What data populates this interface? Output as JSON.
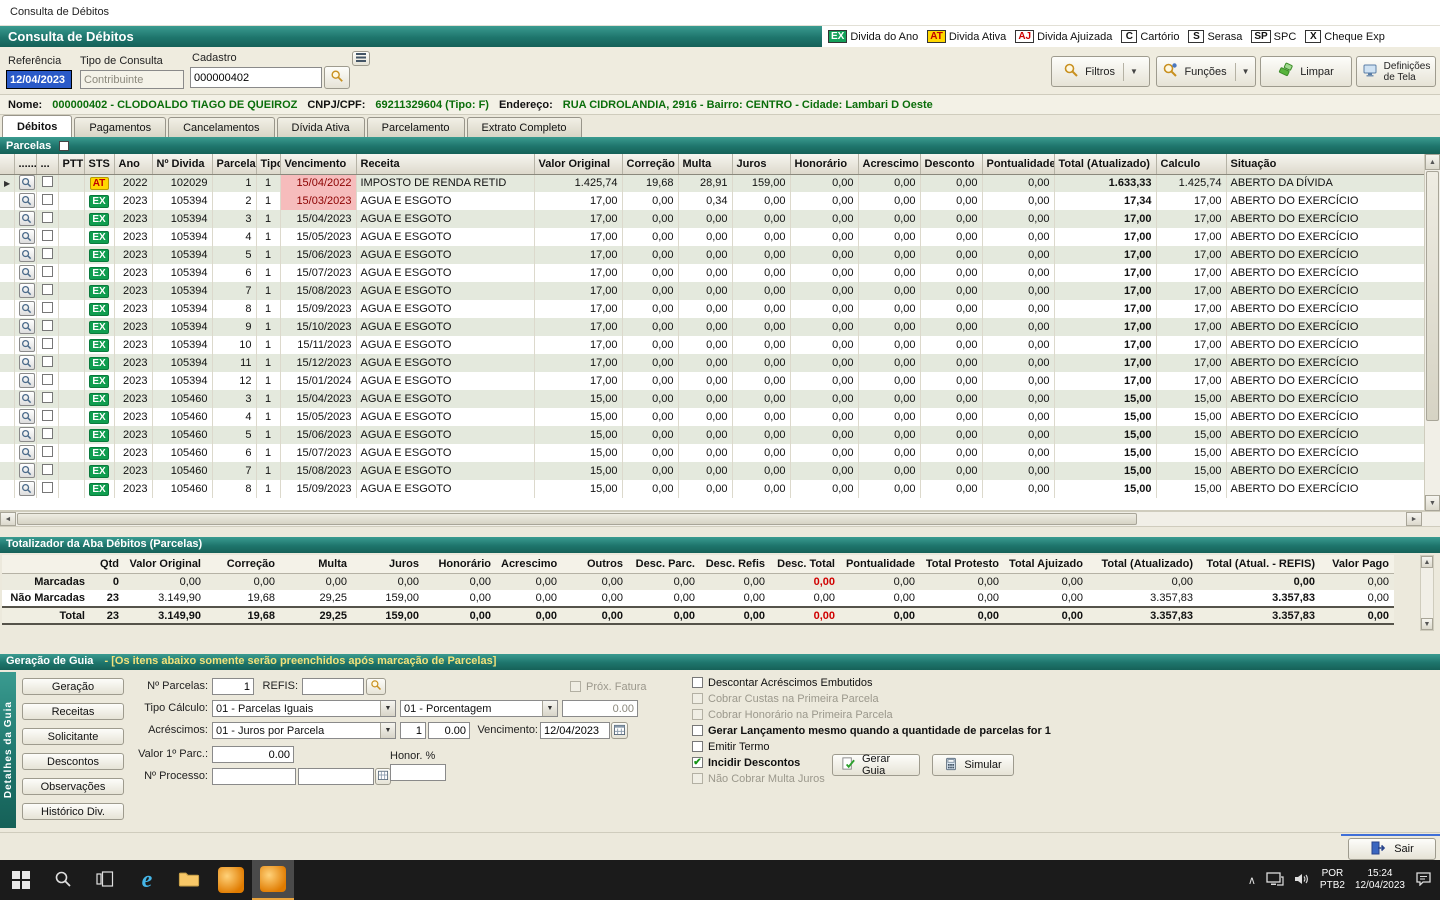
{
  "window": {
    "title": "Consulta de Débitos"
  },
  "header": {
    "title": "Consulta de Débitos",
    "legend": [
      {
        "badge": "EX",
        "label": "Divida do Ano",
        "bg": "#14a05a",
        "fg": "#ffffff"
      },
      {
        "badge": "AT",
        "label": "Divida Ativa",
        "bg": "#ffd800",
        "fg": "#c00000"
      },
      {
        "badge": "AJ",
        "label": "Divida Ajuizada",
        "bg": "#ffffff",
        "fg": "#cc0000"
      },
      {
        "badge": "C",
        "label": "Cartório",
        "bg": "#ffffff",
        "fg": "#111111"
      },
      {
        "badge": "S",
        "label": "Serasa",
        "bg": "#ffffff",
        "fg": "#111111"
      },
      {
        "badge": "SP",
        "label": "SPC",
        "bg": "#ffffff",
        "fg": "#111111"
      },
      {
        "badge": "X",
        "label": "Cheque Exp",
        "bg": "#ffffff",
        "fg": "#111111"
      }
    ]
  },
  "filters": {
    "referencia_label": "Referência",
    "referencia_value": "12/04/2023",
    "tipo_label": "Tipo de Consulta",
    "tipo_value": "Contribuinte",
    "cadastro_label": "Cadastro",
    "cadastro_value": "000000402",
    "filtros_label": "Filtros",
    "funcoes_label": "Funções",
    "limpar_label": "Limpar",
    "definicoes_label": "Definições de Tela"
  },
  "taxpayer": {
    "nome_label": "Nome:",
    "nome_value": "000000402 - CLODOALDO TIAGO DE QUEIROZ",
    "doc_label": "CNPJ/CPF:",
    "doc_value": "69211329604 (Tipo: F)",
    "end_label": "Endereço:",
    "end_value": "RUA CIDROLANDIA, 2916 - Bairro: CENTRO - Cidade: Lambari D Oeste"
  },
  "tabs": [
    {
      "label": "Débitos",
      "active": true
    },
    {
      "label": "Pagamentos"
    },
    {
      "label": "Cancelamentos"
    },
    {
      "label": "Dívida Ativa"
    },
    {
      "label": "Parcelamento"
    },
    {
      "label": "Extrato Completo"
    }
  ],
  "grid": {
    "section_title": "Parcelas",
    "columns": [
      "",
      "......",
      "...",
      "PTT",
      "STS",
      "Ano",
      "Nº Divida",
      "Parcela",
      "Tipo",
      "Vencimento",
      "Receita",
      "Valor Original",
      "Correção",
      "Multa",
      "Juros",
      "Honorário",
      "Acrescimo",
      "Desconto",
      "Pontualidade",
      "Total (Atualizado)",
      "Calculo",
      "Situação"
    ],
    "rows": [
      {
        "sel": true,
        "sts": "AT",
        "ano": "2022",
        "divida": "102029",
        "parcela": "1",
        "tipo": "1",
        "venc": "15/04/2022",
        "overdue": true,
        "receita": "IMPOSTO DE RENDA RETID",
        "valor": "1.425,74",
        "correcao": "19,68",
        "multa": "28,91",
        "juros": "159,00",
        "honorario": "0,00",
        "acrescimo": "0,00",
        "desconto": "0,00",
        "pontualidade": "0,00",
        "total": "1.633,33",
        "calculo": "1.425,74",
        "situacao": "ABERTO DA DÍVIDA"
      },
      {
        "sts": "EX",
        "ano": "2023",
        "divida": "105394",
        "parcela": "2",
        "tipo": "1",
        "venc": "15/03/2023",
        "overdue": true,
        "receita": "AGUA E ESGOTO",
        "valor": "17,00",
        "correcao": "0,00",
        "multa": "0,34",
        "juros": "0,00",
        "honorario": "0,00",
        "acrescimo": "0,00",
        "desconto": "0,00",
        "pontualidade": "0,00",
        "total": "17,34",
        "calculo": "17,00",
        "situacao": "ABERTO DO EXERCÍCIO"
      },
      {
        "sts": "EX",
        "ano": "2023",
        "divida": "105394",
        "parcela": "3",
        "tipo": "1",
        "venc": "15/04/2023",
        "receita": "AGUA E ESGOTO",
        "valor": "17,00",
        "correcao": "0,00",
        "multa": "0,00",
        "juros": "0,00",
        "honorario": "0,00",
        "acrescimo": "0,00",
        "desconto": "0,00",
        "pontualidade": "0,00",
        "total": "17,00",
        "calculo": "17,00",
        "situacao": "ABERTO DO EXERCÍCIO"
      },
      {
        "sts": "EX",
        "ano": "2023",
        "divida": "105394",
        "parcela": "4",
        "tipo": "1",
        "venc": "15/05/2023",
        "receita": "AGUA E ESGOTO",
        "valor": "17,00",
        "correcao": "0,00",
        "multa": "0,00",
        "juros": "0,00",
        "honorario": "0,00",
        "acrescimo": "0,00",
        "desconto": "0,00",
        "pontualidade": "0,00",
        "total": "17,00",
        "calculo": "17,00",
        "situacao": "ABERTO DO EXERCÍCIO"
      },
      {
        "sts": "EX",
        "ano": "2023",
        "divida": "105394",
        "parcela": "5",
        "tipo": "1",
        "venc": "15/06/2023",
        "receita": "AGUA E ESGOTO",
        "valor": "17,00",
        "correcao": "0,00",
        "multa": "0,00",
        "juros": "0,00",
        "honorario": "0,00",
        "acrescimo": "0,00",
        "desconto": "0,00",
        "pontualidade": "0,00",
        "total": "17,00",
        "calculo": "17,00",
        "situacao": "ABERTO DO EXERCÍCIO"
      },
      {
        "sts": "EX",
        "ano": "2023",
        "divida": "105394",
        "parcela": "6",
        "tipo": "1",
        "venc": "15/07/2023",
        "receita": "AGUA E ESGOTO",
        "valor": "17,00",
        "correcao": "0,00",
        "multa": "0,00",
        "juros": "0,00",
        "honorario": "0,00",
        "acrescimo": "0,00",
        "desconto": "0,00",
        "pontualidade": "0,00",
        "total": "17,00",
        "calculo": "17,00",
        "situacao": "ABERTO DO EXERCÍCIO"
      },
      {
        "sts": "EX",
        "ano": "2023",
        "divida": "105394",
        "parcela": "7",
        "tipo": "1",
        "venc": "15/08/2023",
        "receita": "AGUA E ESGOTO",
        "valor": "17,00",
        "correcao": "0,00",
        "multa": "0,00",
        "juros": "0,00",
        "honorario": "0,00",
        "acrescimo": "0,00",
        "desconto": "0,00",
        "pontualidade": "0,00",
        "total": "17,00",
        "calculo": "17,00",
        "situacao": "ABERTO DO EXERCÍCIO"
      },
      {
        "sts": "EX",
        "ano": "2023",
        "divida": "105394",
        "parcela": "8",
        "tipo": "1",
        "venc": "15/09/2023",
        "receita": "AGUA E ESGOTO",
        "valor": "17,00",
        "correcao": "0,00",
        "multa": "0,00",
        "juros": "0,00",
        "honorario": "0,00",
        "acrescimo": "0,00",
        "desconto": "0,00",
        "pontualidade": "0,00",
        "total": "17,00",
        "calculo": "17,00",
        "situacao": "ABERTO DO EXERCÍCIO"
      },
      {
        "sts": "EX",
        "ano": "2023",
        "divida": "105394",
        "parcela": "9",
        "tipo": "1",
        "venc": "15/10/2023",
        "receita": "AGUA E ESGOTO",
        "valor": "17,00",
        "correcao": "0,00",
        "multa": "0,00",
        "juros": "0,00",
        "honorario": "0,00",
        "acrescimo": "0,00",
        "desconto": "0,00",
        "pontualidade": "0,00",
        "total": "17,00",
        "calculo": "17,00",
        "situacao": "ABERTO DO EXERCÍCIO"
      },
      {
        "sts": "EX",
        "ano": "2023",
        "divida": "105394",
        "parcela": "10",
        "tipo": "1",
        "venc": "15/11/2023",
        "receita": "AGUA E ESGOTO",
        "valor": "17,00",
        "correcao": "0,00",
        "multa": "0,00",
        "juros": "0,00",
        "honorario": "0,00",
        "acrescimo": "0,00",
        "desconto": "0,00",
        "pontualidade": "0,00",
        "total": "17,00",
        "calculo": "17,00",
        "situacao": "ABERTO DO EXERCÍCIO"
      },
      {
        "sts": "EX",
        "ano": "2023",
        "divida": "105394",
        "parcela": "11",
        "tipo": "1",
        "venc": "15/12/2023",
        "receita": "AGUA E ESGOTO",
        "valor": "17,00",
        "correcao": "0,00",
        "multa": "0,00",
        "juros": "0,00",
        "honorario": "0,00",
        "acrescimo": "0,00",
        "desconto": "0,00",
        "pontualidade": "0,00",
        "total": "17,00",
        "calculo": "17,00",
        "situacao": "ABERTO DO EXERCÍCIO"
      },
      {
        "sts": "EX",
        "ano": "2023",
        "divida": "105394",
        "parcela": "12",
        "tipo": "1",
        "venc": "15/01/2024",
        "receita": "AGUA E ESGOTO",
        "valor": "17,00",
        "correcao": "0,00",
        "multa": "0,00",
        "juros": "0,00",
        "honorario": "0,00",
        "acrescimo": "0,00",
        "desconto": "0,00",
        "pontualidade": "0,00",
        "total": "17,00",
        "calculo": "17,00",
        "situacao": "ABERTO DO EXERCÍCIO"
      },
      {
        "sts": "EX",
        "ano": "2023",
        "divida": "105460",
        "parcela": "3",
        "tipo": "1",
        "venc": "15/04/2023",
        "receita": "AGUA E ESGOTO",
        "valor": "15,00",
        "correcao": "0,00",
        "multa": "0,00",
        "juros": "0,00",
        "honorario": "0,00",
        "acrescimo": "0,00",
        "desconto": "0,00",
        "pontualidade": "0,00",
        "total": "15,00",
        "calculo": "15,00",
        "situacao": "ABERTO DO EXERCÍCIO"
      },
      {
        "sts": "EX",
        "ano": "2023",
        "divida": "105460",
        "parcela": "4",
        "tipo": "1",
        "venc": "15/05/2023",
        "receita": "AGUA E ESGOTO",
        "valor": "15,00",
        "correcao": "0,00",
        "multa": "0,00",
        "juros": "0,00",
        "honorario": "0,00",
        "acrescimo": "0,00",
        "desconto": "0,00",
        "pontualidade": "0,00",
        "total": "15,00",
        "calculo": "15,00",
        "situacao": "ABERTO DO EXERCÍCIO"
      },
      {
        "sts": "EX",
        "ano": "2023",
        "divida": "105460",
        "parcela": "5",
        "tipo": "1",
        "venc": "15/06/2023",
        "receita": "AGUA E ESGOTO",
        "valor": "15,00",
        "correcao": "0,00",
        "multa": "0,00",
        "juros": "0,00",
        "honorario": "0,00",
        "acrescimo": "0,00",
        "desconto": "0,00",
        "pontualidade": "0,00",
        "total": "15,00",
        "calculo": "15,00",
        "situacao": "ABERTO DO EXERCÍCIO"
      },
      {
        "sts": "EX",
        "ano": "2023",
        "divida": "105460",
        "parcela": "6",
        "tipo": "1",
        "venc": "15/07/2023",
        "receita": "AGUA E ESGOTO",
        "valor": "15,00",
        "correcao": "0,00",
        "multa": "0,00",
        "juros": "0,00",
        "honorario": "0,00",
        "acrescimo": "0,00",
        "desconto": "0,00",
        "pontualidade": "0,00",
        "total": "15,00",
        "calculo": "15,00",
        "situacao": "ABERTO DO EXERCÍCIO"
      },
      {
        "sts": "EX",
        "ano": "2023",
        "divida": "105460",
        "parcela": "7",
        "tipo": "1",
        "venc": "15/08/2023",
        "receita": "AGUA E ESGOTO",
        "valor": "15,00",
        "correcao": "0,00",
        "multa": "0,00",
        "juros": "0,00",
        "honorario": "0,00",
        "acrescimo": "0,00",
        "desconto": "0,00",
        "pontualidade": "0,00",
        "total": "15,00",
        "calculo": "15,00",
        "situacao": "ABERTO DO EXERCÍCIO"
      },
      {
        "sts": "EX",
        "ano": "2023",
        "divida": "105460",
        "parcela": "8",
        "tipo": "1",
        "venc": "15/09/2023",
        "receita": "AGUA E ESGOTO",
        "valor": "15,00",
        "correcao": "0,00",
        "multa": "0,00",
        "juros": "0,00",
        "honorario": "0,00",
        "acrescimo": "0,00",
        "desconto": "0,00",
        "pontualidade": "0,00",
        "total": "15,00",
        "calculo": "15,00",
        "situacao": "ABERTO DO EXERCÍCIO"
      }
    ]
  },
  "totals": {
    "section_title": "Totalizador da Aba Débitos (Parcelas)",
    "columns": [
      "",
      "Qtd",
      "Valor Original",
      "Correção",
      "Multa",
      "Juros",
      "Honorário",
      "Acrescimo",
      "Outros",
      "Desc. Parc.",
      "Desc. Refis",
      "Desc. Total",
      "Pontualidade",
      "Total Protesto",
      "Total Ajuizado",
      "Total (Atualizado)",
      "Total (Atual. - REFIS)",
      "Valor Pago"
    ],
    "rows": [
      {
        "label": "Marcadas",
        "red": true,
        "cells": [
          "0",
          "0,00",
          "0,00",
          "0,00",
          "0,00",
          "0,00",
          "0,00",
          "0,00",
          "0,00",
          "0,00",
          "0,00",
          "0,00",
          "0,00",
          "0,00",
          "0,00",
          "0,00",
          "0,00"
        ]
      },
      {
        "label": "Não Marcadas",
        "cells": [
          "23",
          "3.149,90",
          "19,68",
          "29,25",
          "159,00",
          "0,00",
          "0,00",
          "0,00",
          "0,00",
          "0,00",
          "0,00",
          "0,00",
          "0,00",
          "0,00",
          "3.357,83",
          "3.357,83",
          "0,00"
        ]
      },
      {
        "label": "Total",
        "red": true,
        "bold": true,
        "cells": [
          "23",
          "3.149,90",
          "19,68",
          "29,25",
          "159,00",
          "0,00",
          "0,00",
          "0,00",
          "0,00",
          "0,00",
          "0,00",
          "0,00",
          "0,00",
          "0,00",
          "3.357,83",
          "3.357,83",
          "0,00"
        ]
      }
    ]
  },
  "guia": {
    "section_title": "Geração de Guia",
    "section_note": "-   [Os itens abaixo somente serão preenchidos após marcação de Parcelas]",
    "side_label": "Detalhes da Guia",
    "side_buttons": [
      "Geração",
      "Receitas",
      "Solicitante",
      "Descontos",
      "Observações",
      "Histórico Div."
    ],
    "fields": {
      "num_parcelas_label": "Nº Parcelas:",
      "num_parcelas_value": "1",
      "refis_label": "REFIS:",
      "prox_fatura_label": "Próx. Fatura",
      "tipo_calculo_label": "Tipo Cálculo:",
      "tipo_calculo_value": "01 - Parcelas Iguais",
      "tipo_calculo2_value": "01 - Porcentagem",
      "tipo_calculo_pct": "0.00",
      "acrescimos_label": "Acréscimos:",
      "acrescimos_value": "01 - Juros por Parcela",
      "acrescimos_n": "1",
      "acrescimos_v": "0.00",
      "vencimento_label": "Vencimento:",
      "vencimento_value": "12/04/2023",
      "valor_parc_label": "Valor 1º Parc.:",
      "valor_parc_value": "0.00",
      "honor_label": "Honor. %",
      "processo_label": "Nº Processo:"
    },
    "checkboxes": [
      {
        "label": "Descontar Acréscimos Embutidos",
        "checked": false,
        "disabled": false
      },
      {
        "label": "Cobrar Custas na Primeira Parcela",
        "checked": false,
        "disabled": true
      },
      {
        "label": "Cobrar Honorário na Primeira Parcela",
        "checked": false,
        "disabled": true
      },
      {
        "label": "Gerar Lançamento mesmo quando a quantidade de parcelas for 1",
        "checked": false,
        "disabled": false,
        "bold": true
      },
      {
        "label": "Emitir Termo",
        "checked": false,
        "disabled": false
      },
      {
        "label": "Incidir Descontos",
        "checked": true,
        "disabled": false,
        "bold": true
      },
      {
        "label": "Não Cobrar Multa Juros",
        "checked": false,
        "disabled": true
      }
    ],
    "gerar_label": "Gerar Guia",
    "simular_label": "Simular"
  },
  "sair_label": "Sair",
  "taskbar": {
    "lang1": "POR",
    "lang2": "PTB2",
    "time": "15:24",
    "date": "12/04/2023"
  }
}
